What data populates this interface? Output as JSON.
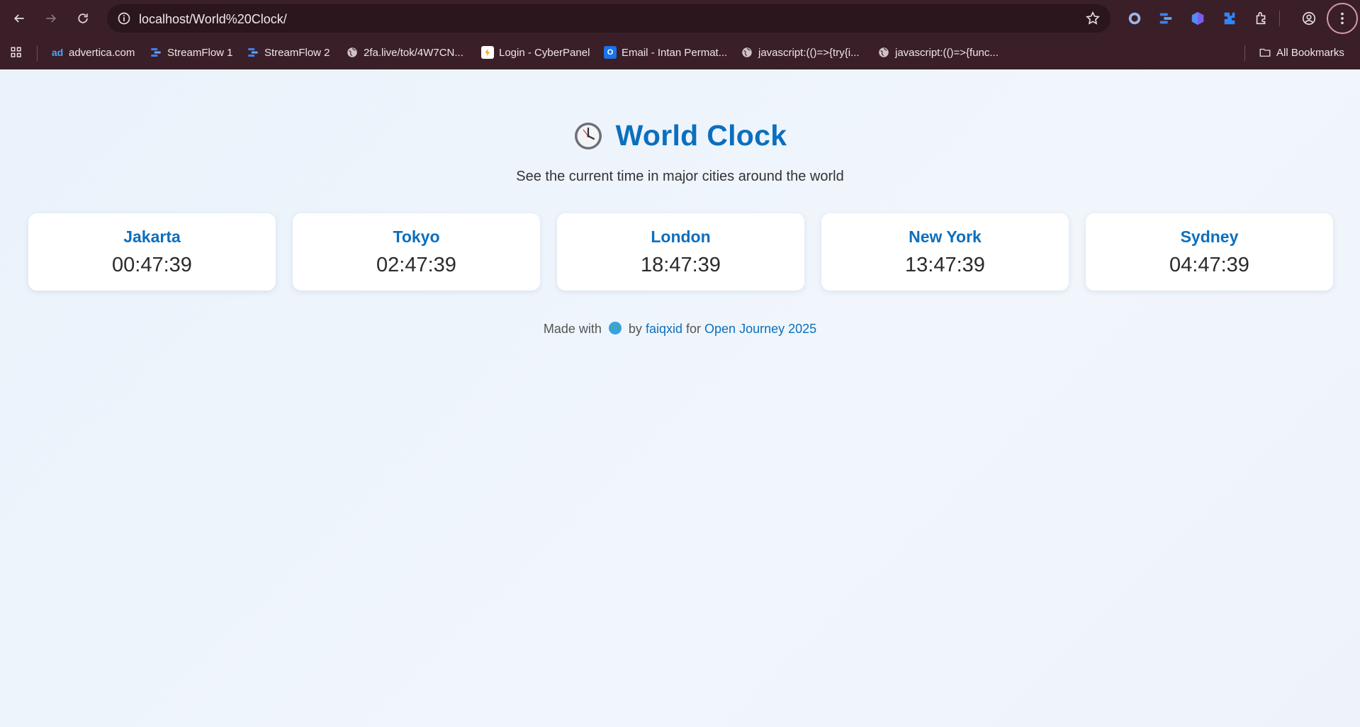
{
  "browser": {
    "url": "localhost/World%20Clock/",
    "bookmarks": [
      {
        "label": "advertica.com",
        "icon": "ad-icon"
      },
      {
        "label": "StreamFlow 1",
        "icon": "streamflow-icon"
      },
      {
        "label": "StreamFlow 2",
        "icon": "streamflow-icon"
      },
      {
        "label": "2fa.live/tok/4W7CN...",
        "icon": "globe-icon"
      },
      {
        "label": "Login - CyberPanel",
        "icon": "cyberpanel-icon"
      },
      {
        "label": "Email - Intan Permat...",
        "icon": "outlook-icon"
      },
      {
        "label": "javascript:(()=>{try{i...",
        "icon": "globe-icon"
      },
      {
        "label": "javascript:(()=>{func...",
        "icon": "globe-icon"
      }
    ],
    "all_bookmarks": "All Bookmarks"
  },
  "page": {
    "title": "World Clock",
    "subtitle": "See the current time in major cities around the world",
    "clocks": [
      {
        "city": "Jakarta",
        "time": "00:47:39"
      },
      {
        "city": "Tokyo",
        "time": "02:47:39"
      },
      {
        "city": "London",
        "time": "18:47:39"
      },
      {
        "city": "New York",
        "time": "13:47:39"
      },
      {
        "city": "Sydney",
        "time": "04:47:39"
      }
    ],
    "footer": {
      "made_with": "Made with",
      "by": "by",
      "author": "faiqxid",
      "for": "for",
      "event": "Open Journey 2025"
    }
  },
  "colors": {
    "accent": "#0b6fbe",
    "chrome_bg": "#3a1f28",
    "page_bg": "#eef4fb"
  }
}
